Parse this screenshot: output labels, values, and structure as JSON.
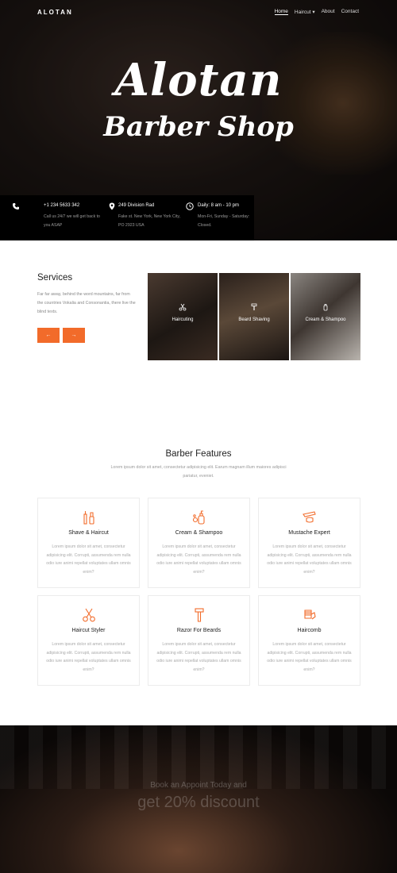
{
  "brand": "ALOTAN",
  "nav": {
    "home": "Home",
    "haircut": "Haircut ▾",
    "about": "About",
    "contact": "Contact"
  },
  "hero": {
    "title": "Alotan",
    "subtitle": "Barber Shop"
  },
  "info": [
    {
      "icon": "phone-icon",
      "head": "+1 234 5633 342",
      "desc": "Call us 24/7 we will get back to you ASAP"
    },
    {
      "icon": "location-pin-icon",
      "head": "249 Division Rad",
      "desc": "Fake st. New York, New York City, PO 2923 USA"
    },
    {
      "icon": "clock-icon",
      "head": "Daily: 8 am - 10 pm",
      "desc": "Mon-Fri, Sunday - Saturday: Closed."
    }
  ],
  "services": {
    "title": "Services",
    "desc": "Far far away, behind the word mountains, far from the countries Vokalia and Consonantia, there live the blind texts.",
    "prev_label": "←",
    "next_label": "→",
    "cards": [
      {
        "label": "Haircuting",
        "icon": "scissors-icon"
      },
      {
        "label": "Beard Shaving",
        "icon": "razor-icon"
      },
      {
        "label": "Cream & Shampoo",
        "icon": "cream-icon"
      }
    ]
  },
  "features": {
    "title": "Barber Features",
    "subtitle": "Lorem ipsum dolor sit amet, consectetur adipisicing elit. Earum magnam illum maiores adipisci pariatur, eveniet.",
    "accent": "#f26b2a",
    "items": [
      {
        "name": "Shave & Haircut",
        "icon": "shave-kit-icon",
        "text": "Lorem ipsum dolor sit amet, consectetur adipisicing elit. Corrupti, assumenda rem nulla odio iure animi repellat voluptates ullam omnis enim?"
      },
      {
        "name": "Cream & Shampoo",
        "icon": "shampoo-icon",
        "text": "Lorem ipsum dolor sit amet, consectetur adipisicing elit. Corrupti, assumenda rem nulla odio iure animi repellat voluptates ullam omnis enim?"
      },
      {
        "name": "Mustache Expert",
        "icon": "mustache-icon",
        "text": "Lorem ipsum dolor sit amet, consectetur adipisicing elit. Corrupti, assumenda rem nulla odio iure animi repellat voluptates ullam omnis enim?"
      },
      {
        "name": "Haircut Styler",
        "icon": "scissors-icon",
        "text": "Lorem ipsum dolor sit amet, consectetur adipisicing elit. Corrupti, assumenda rem nulla odio iure animi repellat voluptates ullam omnis enim?"
      },
      {
        "name": "Razor For Beards",
        "icon": "razor-icon",
        "text": "Lorem ipsum dolor sit amet, consectetur adipisicing elit. Corrupti, assumenda rem nulla odio iure animi repellat voluptates ullam omnis enim?"
      },
      {
        "name": "Haircomb",
        "icon": "comb-icon",
        "text": "Lorem ipsum dolor sit amet, consectetur adipisicing elit. Corrupti, assumenda rem nulla odio iure animi repellat voluptates ullam omnis enim?"
      }
    ]
  },
  "banner": {
    "line1": "Book an Appoint Today and",
    "line2": "get 20% discount"
  }
}
